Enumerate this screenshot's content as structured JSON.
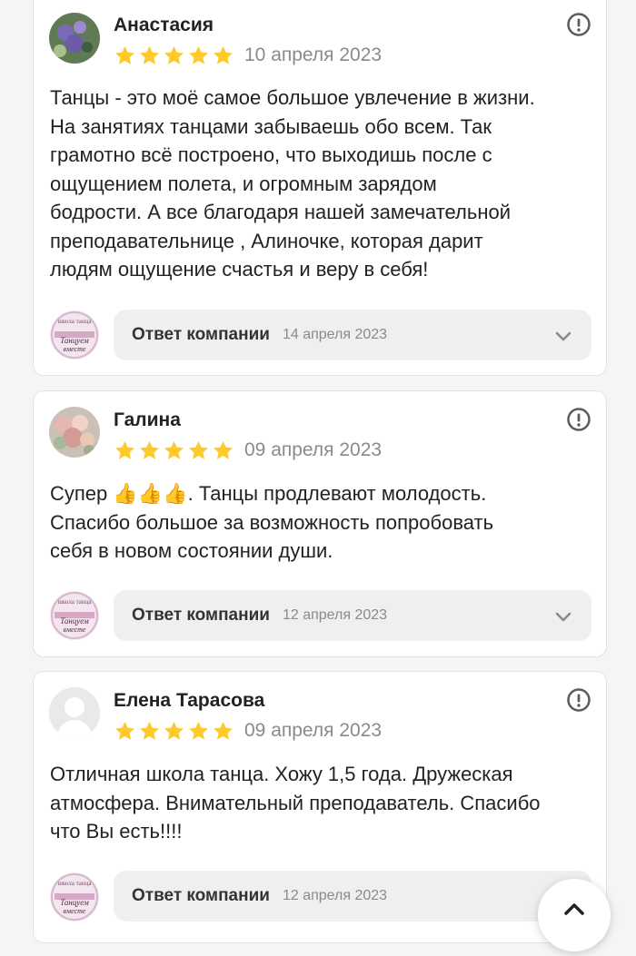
{
  "reviews": [
    {
      "author": "Анастасия",
      "rating": 5,
      "date": "10 апреля 2023",
      "text_lines": [
        "Танцы - это моё самое большое увлечение в жизни.",
        "На занятиях танцами забываешь обо всем. Так",
        "грамотно всё построено, что выходишь после с",
        "ощущением полета, и огромным зарядом",
        "бодрости. А все благодаря нашей замечательной",
        "преподавательнице , Алиночке, которая дарит",
        "людям ощущение счастья и веру в себя!"
      ],
      "reply": {
        "label": "Ответ компании",
        "date": "14 апреля 2023"
      }
    },
    {
      "author": "Галина",
      "rating": 5,
      "date": "09 апреля 2023",
      "text_lines": [
        "Супер",
        ". Танцы продлевают молодость.",
        "Спасибо большое за возможность попробовать",
        "себя в новом состоянии души."
      ],
      "thumbs": "👍👍👍",
      "reply": {
        "label": "Ответ компании",
        "date": "12 апреля 2023"
      }
    },
    {
      "author": "Елена Тарасова",
      "rating": 5,
      "date": "09 апреля 2023",
      "text_lines": [
        "Отличная школа танца. Хожу 1,5 года. Дружеская",
        "атмосфера. Внимательный преподаватель. Спасибо",
        "что Вы есть!!!!"
      ],
      "reply": {
        "label": "Ответ компании",
        "date": "12 апреля 2023"
      }
    }
  ],
  "company_logo": {
    "text_small": "школа танца",
    "text_main": "Танцуем вместе"
  },
  "icons": {
    "star": "star-icon",
    "report": "report-icon",
    "chevron": "chevron-down-icon",
    "fab": "scroll-up-icon"
  },
  "colors": {
    "star": "#fccb2b",
    "card_bg": "#ffffff",
    "reply_bg": "#efefef",
    "date": "#8a8a8a"
  }
}
